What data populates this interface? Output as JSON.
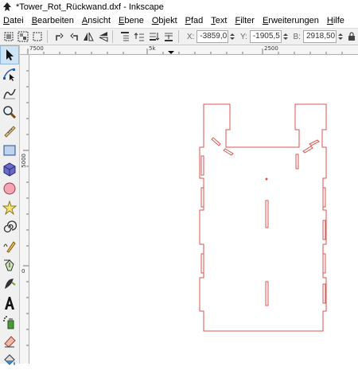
{
  "window": {
    "title": "*Tower_Rot_Rückwand.dxf - Inkscape"
  },
  "menu": {
    "items": [
      {
        "u": "D",
        "rest": "atei"
      },
      {
        "u": "B",
        "rest": "earbeiten"
      },
      {
        "u": "A",
        "rest": "nsicht"
      },
      {
        "u": "E",
        "rest": "bene"
      },
      {
        "u": "O",
        "rest": "bjekt"
      },
      {
        "u": "P",
        "rest": "fad"
      },
      {
        "u": "T",
        "rest": "ext"
      },
      {
        "u": "F",
        "rest": "ilter"
      },
      {
        "u": "E",
        "rest": "rweiterungen"
      },
      {
        "u": "H",
        "rest": "ilfe"
      }
    ]
  },
  "toolbar": {
    "x_label": "X:",
    "x_value": "-3859,0",
    "y_label": "Y:",
    "y_value": "-1905,5",
    "w_label": "B:",
    "w_value": "2918,50"
  },
  "rulers": {
    "h_labels": [
      "7500",
      "5k",
      "2500"
    ],
    "v_labels": [
      "5000",
      "0"
    ]
  },
  "colors": {
    "path_stroke": "#d9534f",
    "chrome": "#f0f0f0"
  },
  "tools": [
    "selector-tool",
    "node-tool",
    "tweak-tool",
    "zoom-tool",
    "measure-tool",
    "rect-tool",
    "3dbox-tool",
    "ellipse-tool",
    "star-tool",
    "spiral-tool",
    "pencil-tool",
    "pen-tool",
    "calligraphy-tool",
    "text-tool",
    "spray-tool",
    "eraser-tool",
    "paint-bucket-tool"
  ]
}
